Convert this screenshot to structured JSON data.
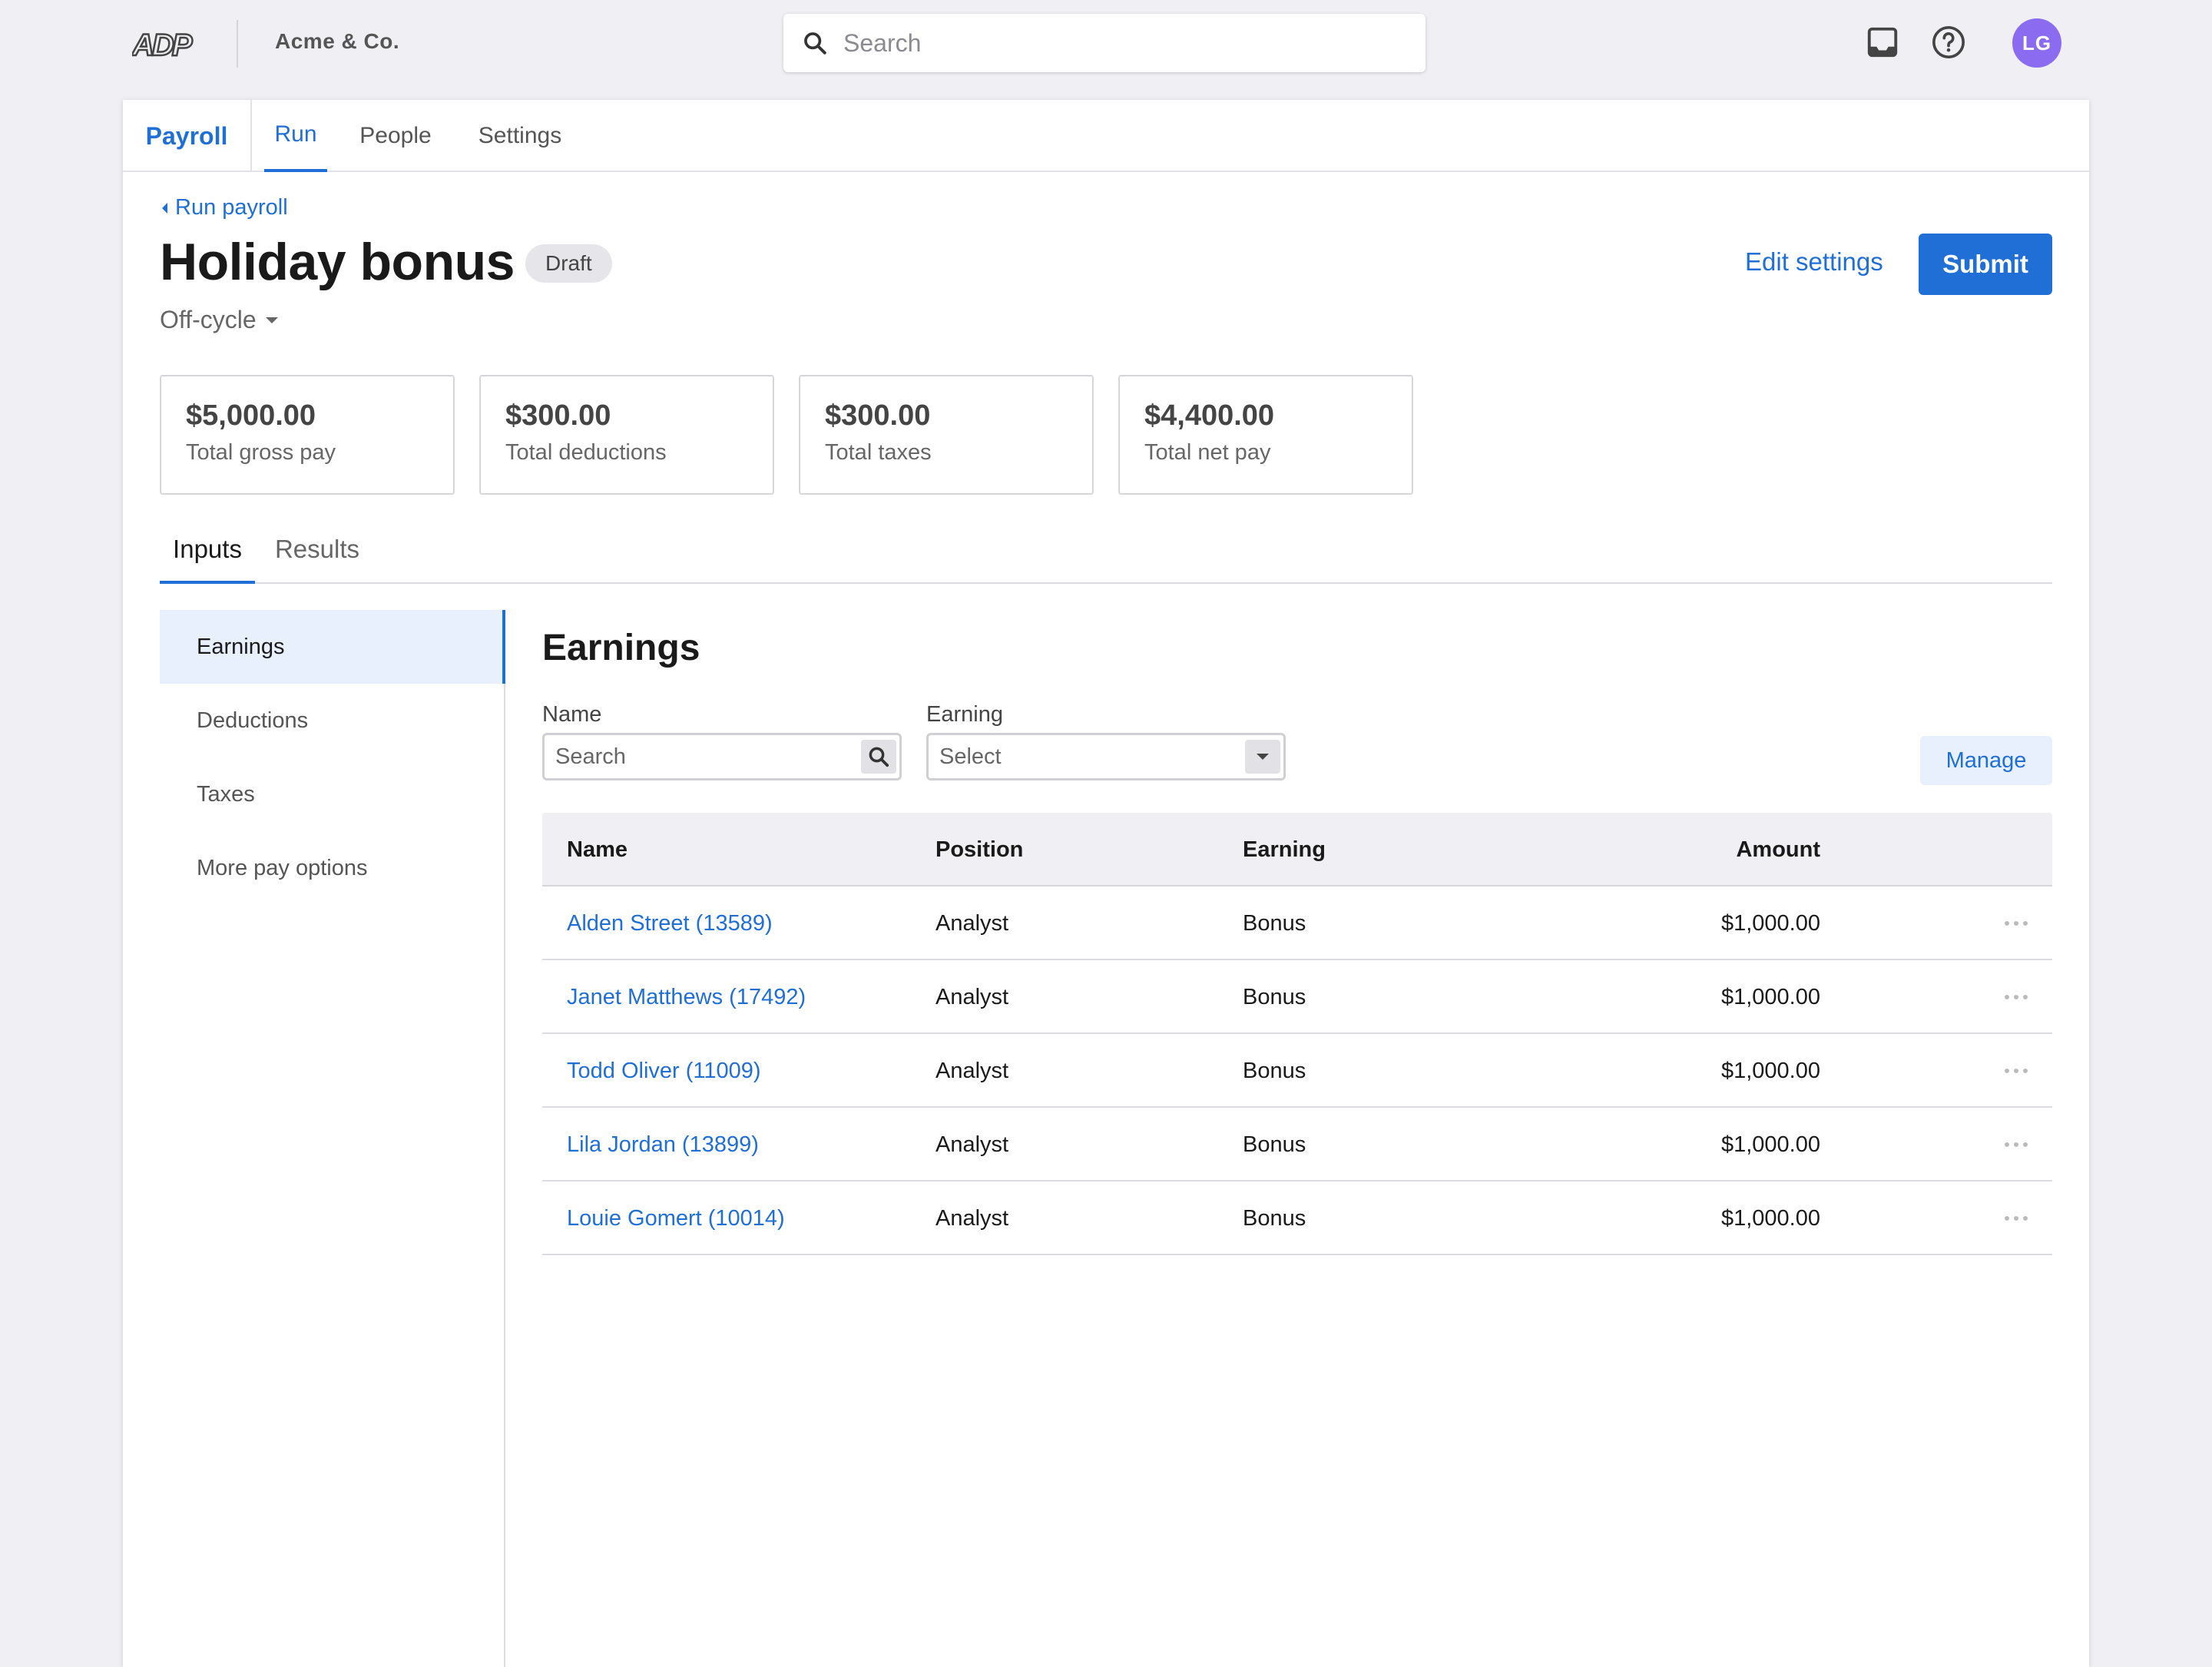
{
  "top_bar": {
    "logo_text": "ADP",
    "company": "Acme & Co.",
    "search_placeholder": "Search",
    "avatar_initials": "LG"
  },
  "nav": {
    "app_name": "Payroll",
    "tabs": [
      {
        "label": "Run",
        "active": true
      },
      {
        "label": "People",
        "active": false
      },
      {
        "label": "Settings",
        "active": false
      }
    ]
  },
  "header": {
    "back_link": "Run payroll",
    "title": "Holiday bonus",
    "status_badge": "Draft",
    "cycle": "Off-cycle",
    "edit_settings": "Edit settings",
    "submit": "Submit"
  },
  "stats": [
    {
      "value": "$5,000.00",
      "label": "Total gross pay"
    },
    {
      "value": "$300.00",
      "label": "Total deductions"
    },
    {
      "value": "$300.00",
      "label": "Total taxes"
    },
    {
      "value": "$4,400.00",
      "label": "Total net pay"
    }
  ],
  "inner_tabs": [
    {
      "label": "Inputs",
      "active": true
    },
    {
      "label": "Results",
      "active": false
    }
  ],
  "side_nav": [
    {
      "label": "Earnings",
      "active": true
    },
    {
      "label": "Deductions",
      "active": false
    },
    {
      "label": "Taxes",
      "active": false
    },
    {
      "label": "More pay options",
      "active": false
    }
  ],
  "earnings": {
    "title": "Earnings",
    "name_label": "Name",
    "name_placeholder": "Search",
    "earning_label": "Earning",
    "earning_value": "Select",
    "manage": "Manage",
    "columns": [
      "Name",
      "Position",
      "Earning",
      "Amount"
    ],
    "rows": [
      {
        "name": "Alden Street (13589)",
        "position": "Analyst",
        "earning": "Bonus",
        "amount": "$1,000.00"
      },
      {
        "name": "Janet Matthews (17492)",
        "position": "Analyst",
        "earning": "Bonus",
        "amount": "$1,000.00"
      },
      {
        "name": "Todd Oliver (11009)",
        "position": "Analyst",
        "earning": "Bonus",
        "amount": "$1,000.00"
      },
      {
        "name": "Lila Jordan (13899)",
        "position": "Analyst",
        "earning": "Bonus",
        "amount": "$1,000.00"
      },
      {
        "name": "Louie Gomert (10014)",
        "position": "Analyst",
        "earning": "Bonus",
        "amount": "$1,000.00"
      }
    ]
  },
  "colors": {
    "accent": "#1f6fd6",
    "avatar": "#8b6cf0",
    "background": "#f0f0f4"
  },
  "icons": [
    "adp-logo",
    "search-icon",
    "inbox-icon",
    "help-icon",
    "chevron-left-icon",
    "caret-down-icon",
    "more-icon"
  ]
}
